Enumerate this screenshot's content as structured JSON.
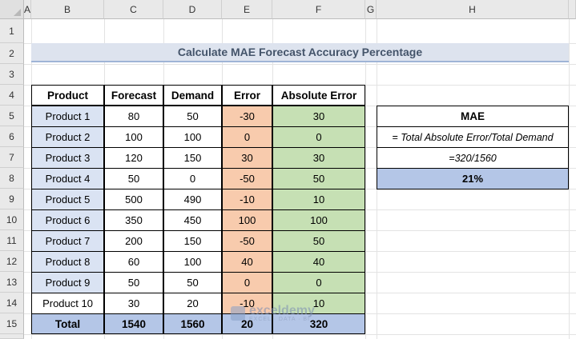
{
  "columns": [
    "A",
    "B",
    "C",
    "D",
    "E",
    "F",
    "G",
    "H"
  ],
  "rows": [
    "1",
    "2",
    "3",
    "4",
    "5",
    "6",
    "7",
    "8",
    "9",
    "10",
    "11",
    "12",
    "13",
    "14",
    "15"
  ],
  "title": "Calculate MAE Forecast Accuracy Percentage",
  "table": {
    "headers": [
      "Product",
      "Forecast",
      "Demand",
      "Error",
      "Absolute Error"
    ],
    "rows": [
      [
        "Product 1",
        "80",
        "50",
        "-30",
        "30"
      ],
      [
        "Product 2",
        "100",
        "100",
        "0",
        "0"
      ],
      [
        "Product 3",
        "120",
        "150",
        "30",
        "30"
      ],
      [
        "Product 4",
        "50",
        "0",
        "-50",
        "50"
      ],
      [
        "Product 5",
        "500",
        "490",
        "-10",
        "10"
      ],
      [
        "Product 6",
        "350",
        "450",
        "100",
        "100"
      ],
      [
        "Product 7",
        "200",
        "150",
        "-50",
        "50"
      ],
      [
        "Product 8",
        "60",
        "100",
        "40",
        "40"
      ],
      [
        "Product 9",
        "50",
        "50",
        "0",
        "0"
      ],
      [
        "Product 10",
        "30",
        "20",
        "-10",
        "10"
      ]
    ],
    "total": [
      "Total",
      "1540",
      "1560",
      "20",
      "320"
    ]
  },
  "mae": {
    "header": "MAE",
    "formula": "= Total Absolute Error/Total Demand",
    "calc": "=320/1560",
    "result": "21%"
  },
  "watermark": {
    "name": "exceldemy",
    "tagline": "EXCEL · DATA · BI"
  },
  "colors": {
    "product": "#dae3f3",
    "error": "#f8cbad",
    "abs_error": "#c6e0b4",
    "total": "#b4c6e7",
    "title_text": "#44546a"
  }
}
